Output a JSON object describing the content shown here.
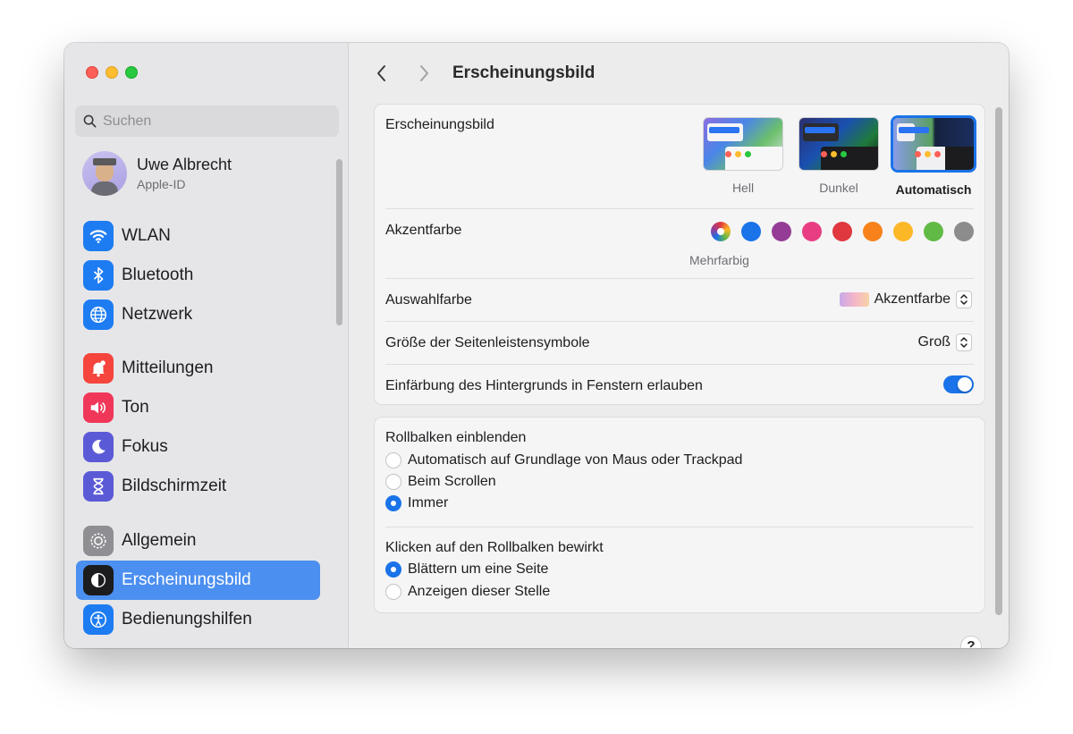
{
  "sidebar": {
    "search_placeholder": "Suchen",
    "account": {
      "name": "Uwe Albrecht",
      "subtitle": "Apple-ID"
    },
    "items": [
      {
        "label": "WLAN",
        "icon": "wifi-icon",
        "color": "#1e7cf2"
      },
      {
        "label": "Bluetooth",
        "icon": "bluetooth-icon",
        "color": "#1e7cf2"
      },
      {
        "label": "Netzwerk",
        "icon": "globe-icon",
        "color": "#1e7cf2"
      },
      {
        "label": "Mitteilungen",
        "icon": "bell-icon",
        "color": "#f5453d"
      },
      {
        "label": "Ton",
        "icon": "speaker-icon",
        "color": "#f0375a"
      },
      {
        "label": "Fokus",
        "icon": "moon-icon",
        "color": "#5b5ad6"
      },
      {
        "label": "Bildschirmzeit",
        "icon": "hourglass-icon",
        "color": "#5b5ad6"
      },
      {
        "label": "Allgemein",
        "icon": "gear-icon",
        "color": "#8e8e93"
      },
      {
        "label": "Erscheinungsbild",
        "icon": "appearance-icon",
        "color": "#1c1c1e",
        "active": true
      },
      {
        "label": "Bedienungshilfen",
        "icon": "accessibility-icon",
        "color": "#1e7cf2"
      }
    ]
  },
  "header": {
    "title": "Erscheinungsbild"
  },
  "appearance": {
    "label": "Erscheinungsbild",
    "options": [
      {
        "label": "Hell",
        "selected": false
      },
      {
        "label": "Dunkel",
        "selected": false
      },
      {
        "label": "Automatisch",
        "selected": true
      }
    ]
  },
  "accent": {
    "label": "Akzentfarbe",
    "caption": "Mehrfarbig",
    "colors": [
      "multicolor",
      "#1a73e8",
      "#953d96",
      "#e93d82",
      "#e0383e",
      "#f7821b",
      "#fcb827",
      "#62ba46",
      "#8c8c8c"
    ]
  },
  "highlight": {
    "label": "Auswahlfarbe",
    "value": "Akzentfarbe"
  },
  "sidebar_icon_size": {
    "label": "Größe der Seitenleistensymbole",
    "value": "Groß"
  },
  "wallpaper_tinting": {
    "label": "Einfärbung des Hintergrunds in Fenstern erlauben",
    "enabled": true
  },
  "scrollbars": {
    "label": "Rollbalken einblenden",
    "options": [
      {
        "label": "Automatisch auf Grundlage von Maus oder Trackpad",
        "selected": false
      },
      {
        "label": "Beim Scrollen",
        "selected": false
      },
      {
        "label": "Immer",
        "selected": true
      }
    ]
  },
  "click_scrollbar": {
    "label": "Klicken auf den Rollbalken bewirkt",
    "options": [
      {
        "label": "Blättern um eine Seite",
        "selected": true
      },
      {
        "label": "Anzeigen dieser Stelle",
        "selected": false
      }
    ]
  },
  "help_label": "?"
}
